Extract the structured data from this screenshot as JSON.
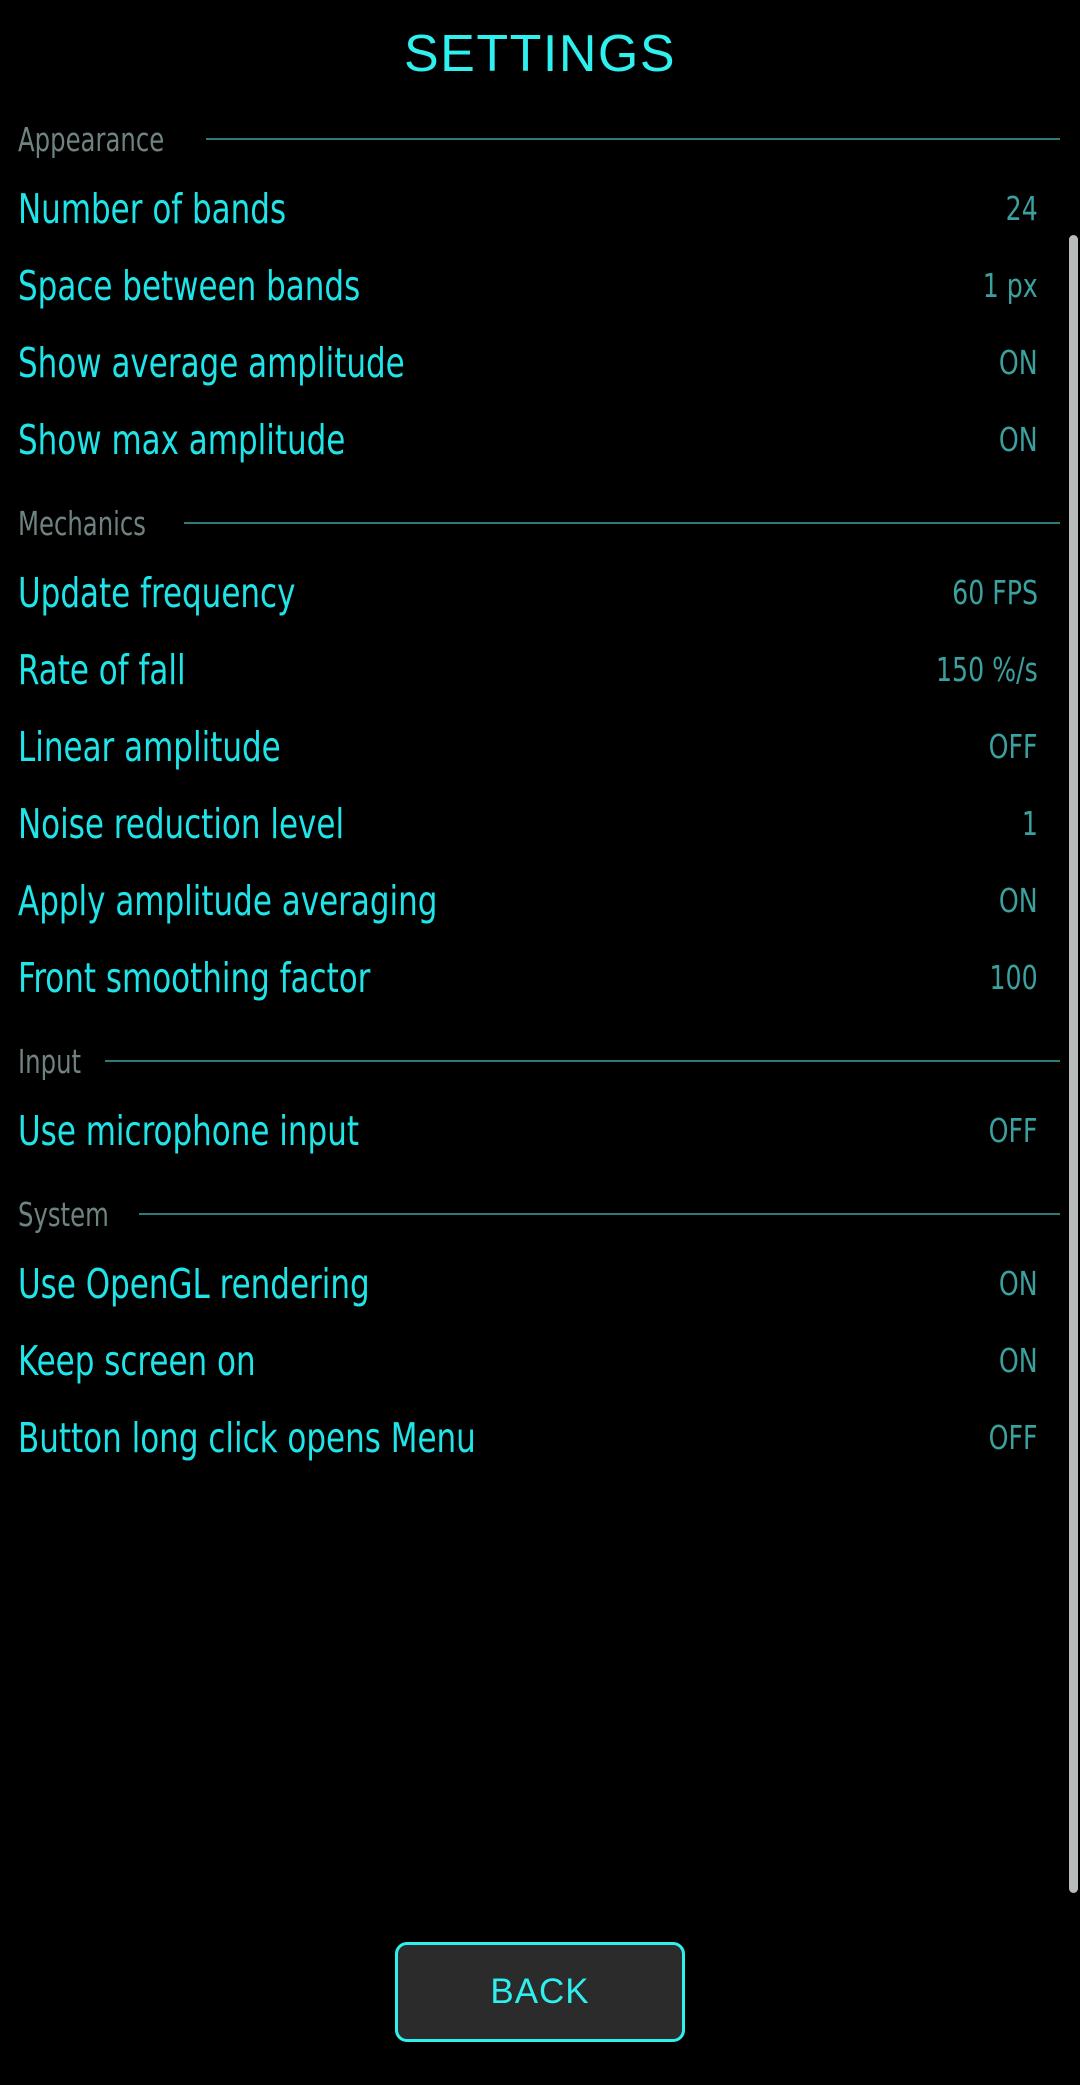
{
  "screen": {
    "title": "SETTINGS",
    "background_color": "#000000",
    "accent_color": "#1fe4e8",
    "value_color": "#3ba09e",
    "section_label_color": "#6e8381",
    "rule_color": "#2f7a78"
  },
  "sections": [
    {
      "label": "Appearance",
      "rows": [
        {
          "label": "Number of bands",
          "value": "24"
        },
        {
          "label": "Space between bands",
          "value": "1 px"
        },
        {
          "label": "Show average amplitude",
          "value": "ON"
        },
        {
          "label": "Show max amplitude",
          "value": "ON"
        }
      ]
    },
    {
      "label": "Mechanics",
      "rows": [
        {
          "label": "Update frequency",
          "value": "60 FPS"
        },
        {
          "label": "Rate of fall",
          "value": "150 %/s"
        },
        {
          "label": "Linear amplitude",
          "value": "OFF"
        },
        {
          "label": "Noise reduction level",
          "value": "1"
        },
        {
          "label": "Apply amplitude averaging",
          "value": "ON"
        },
        {
          "label": "Front smoothing factor",
          "value": "100"
        }
      ]
    },
    {
      "label": "Input",
      "rows": [
        {
          "label": "Use microphone input",
          "value": "OFF"
        }
      ]
    },
    {
      "label": "System",
      "rows": [
        {
          "label": "Use OpenGL rendering",
          "value": "ON"
        },
        {
          "label": "Keep screen on",
          "value": "ON"
        },
        {
          "label": "Button long click opens Menu",
          "value": "OFF"
        }
      ]
    }
  ],
  "footer": {
    "back_label": "BACK"
  },
  "scrollbar": {
    "orientation": "vertical",
    "position": "right"
  }
}
